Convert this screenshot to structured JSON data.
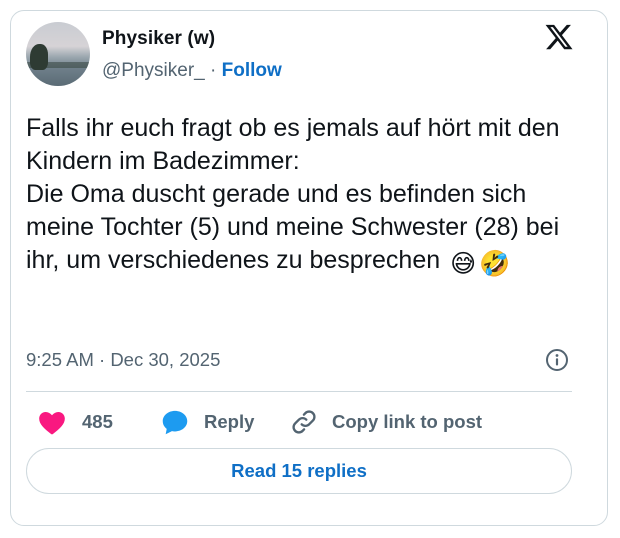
{
  "author": {
    "display_name": "Physiker (w)",
    "handle": "@Physiker_",
    "separator": "·",
    "follow_label": "Follow"
  },
  "brand_icon": "x-logo-icon",
  "tweet": {
    "text": "Falls ihr euch fragt ob es jemals auf hört mit den Kindern im Badezimmer:\nDie Oma duscht gerade und es befinden sich meine Tochter (5) und meine Schwester (28) bei ihr, um verschiedenes zu besprechen",
    "emojis": [
      "😅",
      "🤣"
    ],
    "timestamp": "9:25 AM · Dec 30, 2025"
  },
  "actions": {
    "like_count": "485",
    "reply_label": "Reply",
    "copy_link_label": "Copy link to post"
  },
  "read_replies_label": "Read 15 replies",
  "colors": {
    "accent": "#0f6fc6",
    "like": "#f91880",
    "reply_icon": "#1d9bf0",
    "muted": "#536471",
    "border": "#cfd9de"
  }
}
